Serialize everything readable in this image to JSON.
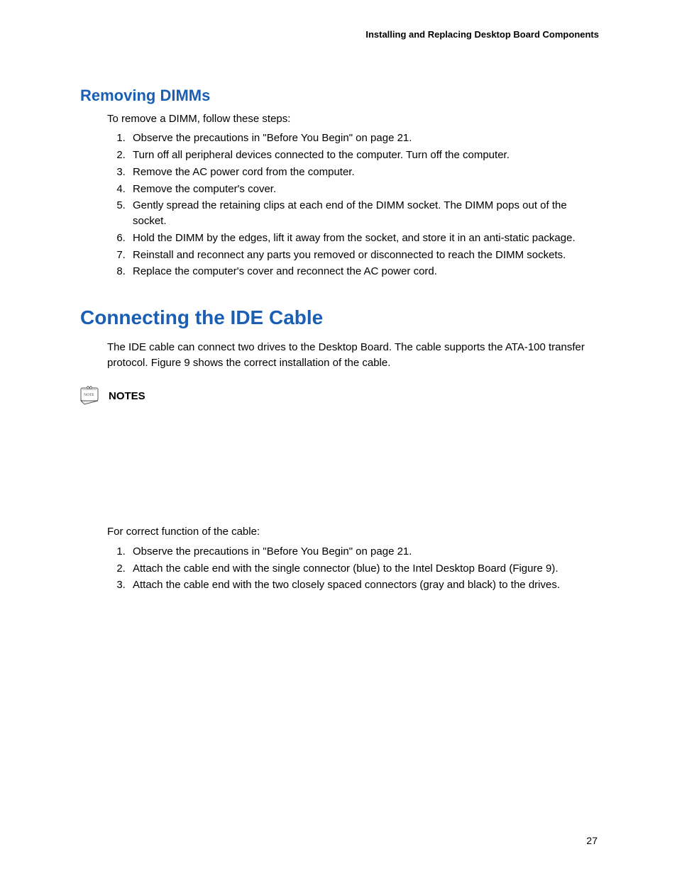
{
  "header": {
    "running_title": "Installing and Replacing Desktop Board Components"
  },
  "removing_dimms": {
    "title": "Removing DIMMs",
    "intro": "To remove a DIMM, follow these steps:",
    "steps": [
      "Observe the precautions in \"Before You Begin\" on page 21.",
      "Turn off all peripheral devices connected to the computer.  Turn off the computer.",
      "Remove the AC power cord from the computer.",
      "Remove the computer's cover.",
      "Gently spread the retaining clips at each end of the DIMM socket.  The DIMM pops out of the socket.",
      "Hold the DIMM by the edges, lift it away from the socket, and store it in an anti-static package.",
      "Reinstall and reconnect any parts you removed or disconnected to reach the DIMM sockets.",
      "Replace the computer's cover and reconnect the AC power cord."
    ]
  },
  "connecting_ide": {
    "title": "Connecting the IDE Cable",
    "intro": "The IDE cable can connect two drives to the Desktop Board.  The cable supports the ATA-100 transfer protocol.  Figure 9 shows the correct installation of the cable.",
    "notes_label": "NOTES",
    "function_intro": "For correct function of the cable:",
    "steps": [
      "Observe the precautions in \"Before You Begin\" on page 21.",
      "Attach the cable end with the single connector (blue) to the Intel Desktop Board (Figure 9).",
      "Attach the cable end with the two closely spaced connectors (gray and black) to the drives."
    ]
  },
  "page_number": "27"
}
